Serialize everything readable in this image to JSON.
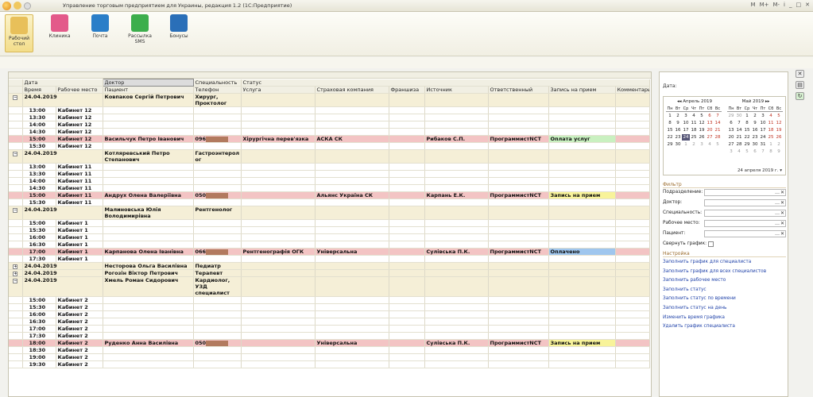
{
  "window": {
    "title": "Управление торговым предприятием для Украины, редакция 1.2  (1С:Предприятие)",
    "right_controls": [
      "M",
      "M+",
      "M-",
      "i",
      "_",
      "□",
      "✕"
    ]
  },
  "toolbar": {
    "items": [
      {
        "name": "desktop",
        "label": "Рабочий стол",
        "color": "#e8c05a"
      },
      {
        "name": "clinic",
        "label": "Клиника",
        "color": "#e35a8a"
      },
      {
        "name": "mail",
        "label": "Почта",
        "color": "#2a7ec8"
      },
      {
        "name": "sms",
        "label": "Рассылка SMS",
        "color": "#3cae4c"
      },
      {
        "name": "bonus",
        "label": "Бонусы",
        "color": "#2a6fb8"
      }
    ]
  },
  "table": {
    "header_row1": [
      "Дата",
      "",
      "Доктор",
      "Специальность",
      "Статус"
    ],
    "header_row2": [
      "Время",
      "Рабочее место",
      "Пациент",
      "Телефон",
      "Услуга",
      "Страховая компания",
      "Франшиза",
      "Источник",
      "Ответственный",
      "Запись на прием",
      "Комментарий"
    ],
    "rows": [
      {
        "type": "group",
        "date": "24.04.2019",
        "doctor": "Ковпаков Сергій Петрович",
        "spec": "Хирург, Проктолог",
        "tall": true,
        "exp": "minus"
      },
      {
        "type": "slot",
        "time": "13:00",
        "place": "Кабинет 12"
      },
      {
        "type": "slot",
        "time": "13:30",
        "place": "Кабинет 12"
      },
      {
        "type": "slot",
        "time": "14:00",
        "place": "Кабинет 12"
      },
      {
        "type": "slot",
        "time": "14:30",
        "place": "Кабинет 12"
      },
      {
        "type": "booked",
        "time": "15:00",
        "place": "Кабинет 12",
        "patient": "Васильчук Петро Іванович",
        "phone": "096",
        "service": "Хірургічна перев'язка",
        "insurer": "АСКА СК",
        "source": "Рибаков С.П.",
        "resp": "ПрограммистNCT",
        "status": "Оплата услуг",
        "status_color": "green"
      },
      {
        "type": "slot",
        "time": "15:30",
        "place": "Кабинет 12"
      },
      {
        "type": "group",
        "date": "24.04.2019",
        "doctor": "Котляревський Петро Степанович",
        "spec": "Гастроэнтерол ог",
        "tall": true,
        "exp": "minus"
      },
      {
        "type": "slot",
        "time": "13:00",
        "place": "Кабинет 11"
      },
      {
        "type": "slot",
        "time": "13:30",
        "place": "Кабинет 11"
      },
      {
        "type": "slot",
        "time": "14:00",
        "place": "Кабинет 11"
      },
      {
        "type": "slot",
        "time": "14:30",
        "place": "Кабинет 11"
      },
      {
        "type": "booked",
        "time": "15:00",
        "place": "Кабинет 11",
        "patient": "Андрух Олена Валеріївна",
        "phone": "050",
        "service": "",
        "insurer": "Альянс Україна СК",
        "source": "Карпань Е.К.",
        "resp": "ПрограммистNCT",
        "status": "Запись на прием",
        "status_color": "yellow"
      },
      {
        "type": "slot",
        "time": "15:30",
        "place": "Кабинет 11"
      },
      {
        "type": "group",
        "date": "24.04.2019",
        "doctor": "Малиновська Юлія Володимирівна",
        "spec": "Рентгенолог",
        "tall": true,
        "exp": "minus"
      },
      {
        "type": "slot",
        "time": "15:00",
        "place": "Кабинет 1"
      },
      {
        "type": "slot",
        "time": "15:30",
        "place": "Кабинет 1"
      },
      {
        "type": "slot",
        "time": "16:00",
        "place": "Кабинет 1"
      },
      {
        "type": "slot",
        "time": "16:30",
        "place": "Кабинет 1"
      },
      {
        "type": "booked",
        "time": "17:00",
        "place": "Кабинет 1",
        "patient": "Карпанова Олена Іванівна",
        "phone": "066",
        "service": "Рентгенографія ОГК",
        "insurer": "Універсальна",
        "source": "Сулівська П.К.",
        "resp": "ПрограммистNCT",
        "status": "Оплачено",
        "status_color": "blue"
      },
      {
        "type": "slot",
        "time": "17:30",
        "place": "Кабинет 1"
      },
      {
        "type": "group",
        "date": "24.04.2019",
        "doctor": "Несторова Ольга Василівна",
        "spec": "Педиатр",
        "tall": false,
        "exp": "plus"
      },
      {
        "type": "group",
        "date": "24.04.2019",
        "doctor": "Рогозін Віктор Петрович",
        "spec": "Терапевт",
        "tall": false,
        "exp": "plus"
      },
      {
        "type": "group",
        "date": "24.04.2019",
        "doctor": "Хмель Роман Сидорович",
        "spec": "Кардиолог, УЗД специалист",
        "tall": true,
        "exp": "minus"
      },
      {
        "type": "slot",
        "time": "15:00",
        "place": "Кабинет 2"
      },
      {
        "type": "slot",
        "time": "15:30",
        "place": "Кабинет 2"
      },
      {
        "type": "slot",
        "time": "16:00",
        "place": "Кабинет 2"
      },
      {
        "type": "slot",
        "time": "16:30",
        "place": "Кабинет 2"
      },
      {
        "type": "slot",
        "time": "17:00",
        "place": "Кабинет 2"
      },
      {
        "type": "slot",
        "time": "17:30",
        "place": "Кабинет 2"
      },
      {
        "type": "booked",
        "time": "18:00",
        "place": "Кабинет 2",
        "patient": "Руденко Анна Василівна",
        "phone": "050",
        "service": "",
        "insurer": "Універсальна",
        "source": "Сулівська П.К.",
        "resp": "ПрограммистNCT",
        "status": "Запись на прием",
        "status_color": "yellow"
      },
      {
        "type": "slot",
        "time": "18:30",
        "place": "Кабинет 2"
      },
      {
        "type": "slot",
        "time": "19:00",
        "place": "Кабинет 2"
      },
      {
        "type": "slot",
        "time": "19:30",
        "place": "Кабинет 2"
      }
    ]
  },
  "status_colors": {
    "green": "#c9f0c0",
    "yellow": "#f8f39a",
    "blue": "#9fc6ee"
  },
  "side": {
    "date_label": "Дата:",
    "calendar": {
      "months": [
        {
          "title": "Апрель 2019",
          "first_weekday": 0,
          "days": 30,
          "prev_tail": [],
          "next_head": [
            1,
            2,
            3,
            4,
            5
          ]
        },
        {
          "title": "Май 2019",
          "first_weekday": 2,
          "days": 31,
          "prev_tail": [
            29,
            30
          ],
          "next_head": [
            1,
            2,
            3,
            4,
            5,
            6,
            7,
            8,
            9
          ]
        }
      ],
      "weekdays": [
        "Пн",
        "Вт",
        "Ср",
        "Чт",
        "Пт",
        "Сб",
        "Вс"
      ],
      "today_day": 24,
      "footer": "24 апреля 2019 г."
    },
    "filter_title": "Фильтр",
    "filters": [
      "Подразделение:",
      "Доктор:",
      "Специальность:",
      "Рабочее место:",
      "Пациент:"
    ],
    "collapse_label": "Свернуть график:",
    "settings_title": "Настройка",
    "links": [
      "Заполнить график для специалиста",
      "Заполнить график для всех специалистов",
      "Заполнить рабочее место",
      "Заполнить статус",
      "Заполнить статус по времени",
      "Заполнить статус на день",
      "Изменить время графика",
      "Удалить график специалиста"
    ]
  }
}
